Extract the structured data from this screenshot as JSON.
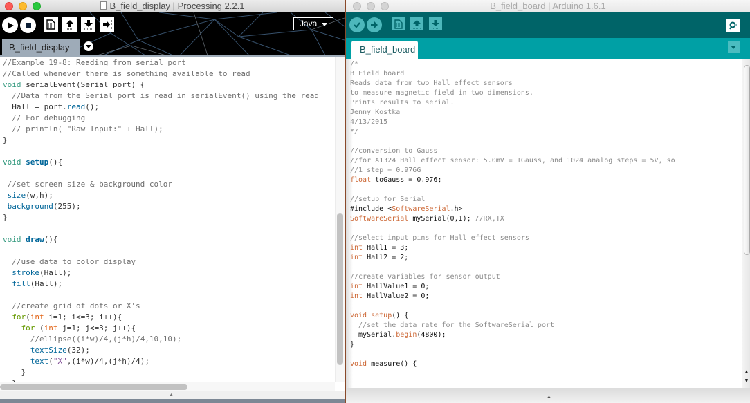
{
  "processing": {
    "window_title": "B_field_display | Processing 2.2.1",
    "toolbar": {
      "run_icon": "play-icon",
      "stop_icon": "stop-icon",
      "new_icon": "new-file-icon",
      "open_icon": "open-upload-icon",
      "save_icon": "save-download-icon",
      "export_icon": "export-arrow-icon"
    },
    "mode": "Java",
    "tab": "B_field_display",
    "code_lines": [
      "//Example 19-8: Reading from serial port",
      "//Called whenever there is something available to read",
      "void serialEvent(Serial port) {",
      "  //Data from the Serial port is read in serialEvent() using the read",
      "  Hall = port.read();",
      "  // For debugging",
      "  // println( \"Raw Input:\" + Hall);",
      "}",
      "",
      "void setup(){",
      "",
      " //set screen size & background color",
      " size(w,h);",
      " background(255);",
      "}",
      "",
      "void draw(){",
      "",
      "  //use data to color display",
      "  stroke(Hall);",
      "  fill(Hall);",
      "",
      "  //create grid of dots or X's",
      "  for(int i=1; i<=3; i++){",
      "    for (int j=1; j<=3; j++){",
      "      //ellipse((i*w)/4,(j*h)/4,10,10);",
      "      textSize(32);",
      "      text(\"X\",(i*w)/4,(j*h)/4);",
      "    }",
      "  }"
    ],
    "colors": {
      "header_bg": "#000000",
      "tab_bg": "#9eabb8",
      "keyword": "#33997e",
      "function": "#006699",
      "type": "#e2661a",
      "control": "#669900",
      "string": "#7d4793",
      "comment": "#6e6e6e"
    }
  },
  "arduino": {
    "window_title": "B_field_board | Arduino 1.6.1",
    "toolbar": {
      "verify_icon": "checkmark-icon",
      "upload_icon": "arrow-right-icon",
      "new_icon": "new-file-icon",
      "open_icon": "open-upload-icon",
      "save_icon": "save-download-icon",
      "serial_monitor_icon": "magnifier-icon"
    },
    "tab": "B_field_board",
    "code_lines": [
      "/*",
      "B Field board",
      "",
      "Reads data from two Hall effect sensors",
      "to measure magnetic field in two dimensions.",
      "Prints results to serial.",
      "",
      "Jenny Kostka",
      "4/13/2015",
      "*/",
      "",
      "//conversion to Gauss",
      "//for A1324 Hall effect sensor: 5.0mV = 1Gauss, and 1024 analog steps = 5V, so",
      "//1 step = 0.976G",
      "float toGauss = 0.976;",
      "",
      "//setup for Serial",
      "#include <SoftwareSerial.h>",
      "SoftwareSerial mySerial(0,1); //RX,TX",
      "",
      "//select input pins for Hall effect sensors",
      "int Hall1 = 3;",
      "int Hall2 = 2;",
      "",
      "//create variables for sensor output",
      "int HallValue1 = 0;",
      "int HallValue2 = 0;",
      "",
      "void setup() {",
      "  //set the data rate for the SoftwareSerial port",
      "  mySerial.begin(4800);",
      "}",
      "",
      "void measure() {"
    ],
    "colors": {
      "toolbar_bg": "#006468",
      "tabbar_bg": "#00a0a5",
      "button_bg": "#4db7bb",
      "keyword": "#cc6633",
      "comment": "#8a8a8a"
    }
  }
}
